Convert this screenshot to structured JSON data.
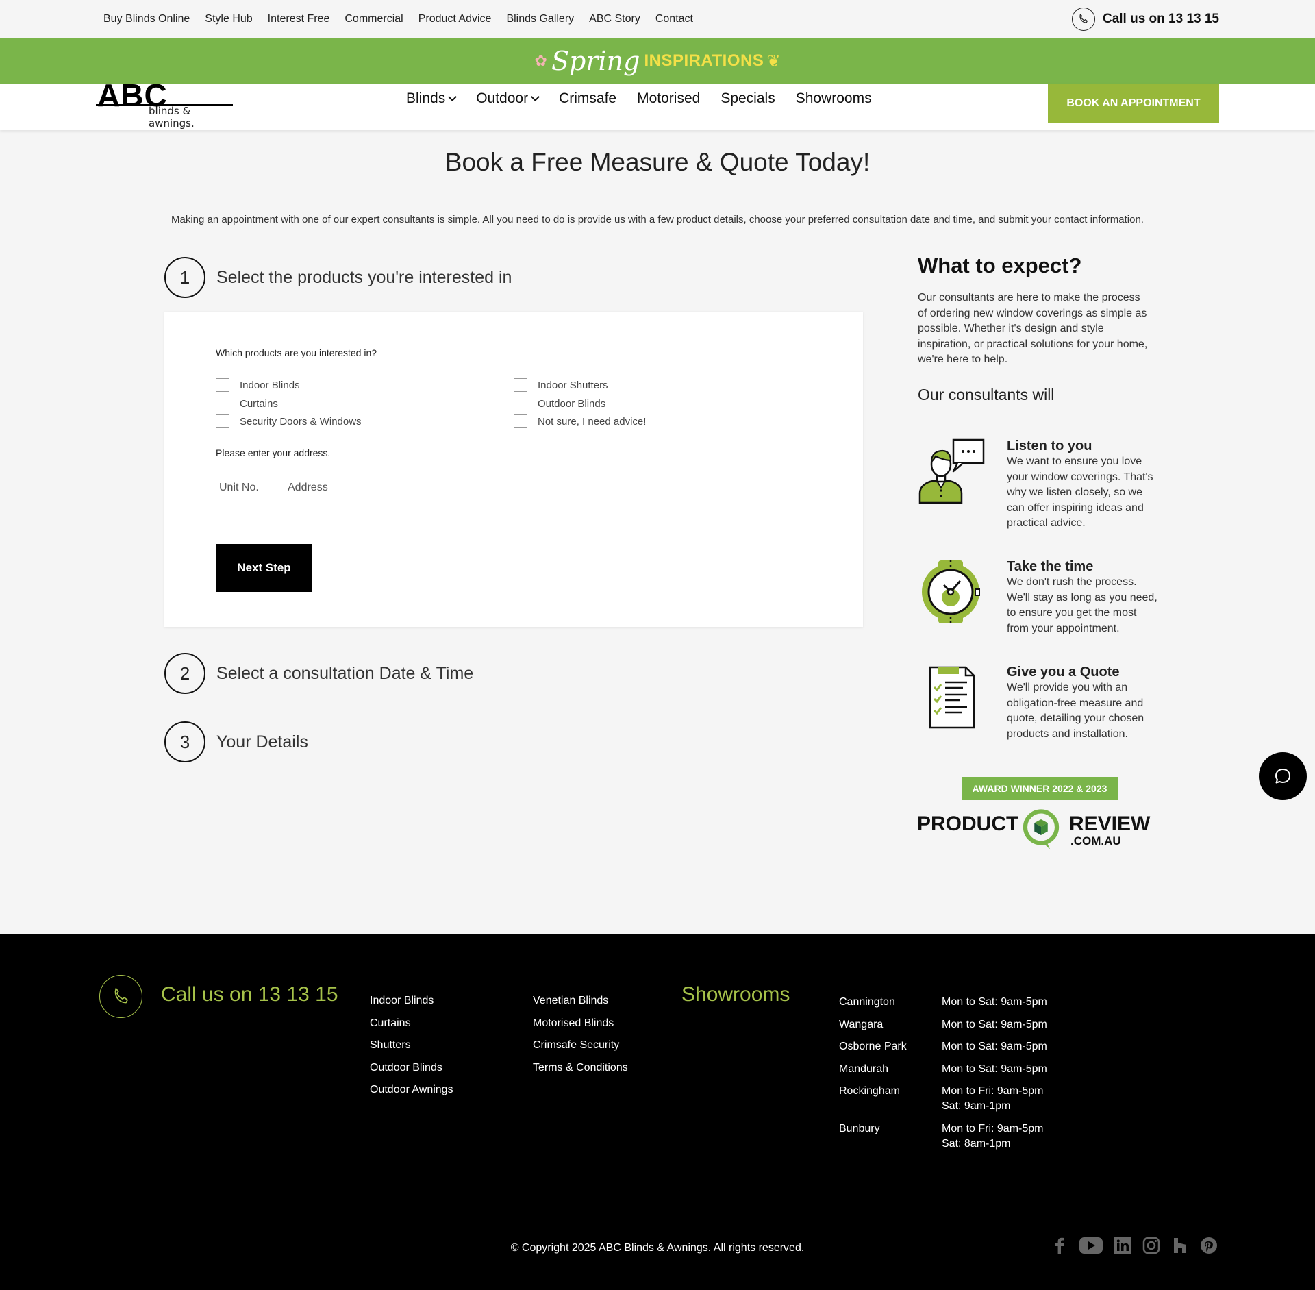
{
  "topnav": {
    "links": [
      "Buy Blinds Online",
      "Style Hub",
      "Interest Free",
      "Commercial",
      "Product Advice",
      "Blinds Gallery",
      "ABC Story",
      "Contact"
    ],
    "call": "Call us on 13 13 15"
  },
  "promo": {
    "script": "Spring",
    "word": "INSPIRATIONS"
  },
  "header": {
    "logo_main": "ABC",
    "logo_sub": "blinds & awnings.",
    "nav": [
      "Blinds",
      "Outdoor",
      "Crimsafe",
      "Motorised",
      "Specials",
      "Showrooms"
    ],
    "book": "BOOK AN APPOINTMENT"
  },
  "page": {
    "title": "Book a Free Measure & Quote Today!",
    "intro": "Making an appointment with one of our expert consultants is simple. All you need to do is provide us with a few product details, choose your preferred consultation date and time, and submit your contact information."
  },
  "steps": [
    {
      "num": "1",
      "title": "Select the products you're interested in"
    },
    {
      "num": "2",
      "title": "Select a consultation Date & Time"
    },
    {
      "num": "3",
      "title": "Your Details"
    }
  ],
  "form": {
    "products_q": "Which products are you interested in?",
    "products": [
      "Indoor Blinds",
      "Curtains",
      "Security Doors & Windows",
      "Indoor Shutters",
      "Outdoor Blinds",
      "Not sure, I need advice!"
    ],
    "address_q": "Please enter your address.",
    "unit_placeholder": "Unit No.",
    "address_placeholder": "Address",
    "next": "Next Step"
  },
  "sidebar": {
    "title": "What to expect?",
    "desc": "Our consultants are here to make the process of ordering new window coverings as simple as possible. Whether it's design and style inspiration, or practical solutions for your home, we're here to help.",
    "sub": "Our consultants will",
    "features": [
      {
        "title": "Listen to you",
        "desc": "We want to ensure you love your window coverings. That's why we listen closely, so we can offer inspiring ideas and practical advice."
      },
      {
        "title": "Take the time",
        "desc": "We don't rush the process. We'll stay as long as you need, to ensure you get the most from your appointment."
      },
      {
        "title": "Give you a Quote",
        "desc": "We'll provide you with an obligation-free measure and quote, detailing your chosen products and installation."
      }
    ],
    "award": "AWARD WINNER 2022 & 2023",
    "pr_left": "PRODUCT",
    "pr_right": "REVIEW",
    "pr_domain": ".COM.AU"
  },
  "footer": {
    "call": "Call us on 13 13 15",
    "col1": [
      "Indoor Blinds",
      "Curtains",
      "Shutters",
      "Outdoor Blinds",
      "Outdoor Awnings"
    ],
    "col2": [
      "Venetian Blinds",
      "Motorised Blinds",
      "Crimsafe Security",
      "Terms & Conditions"
    ],
    "showrooms_title": "Showrooms",
    "showrooms": [
      {
        "name": "Cannington",
        "hours": "Mon to Sat: 9am-5pm"
      },
      {
        "name": "Wangara",
        "hours": "Mon to Sat: 9am-5pm"
      },
      {
        "name": "Osborne Park",
        "hours": "Mon to Sat: 9am-5pm"
      },
      {
        "name": "Mandurah",
        "hours": "Mon to Sat: 9am-5pm"
      },
      {
        "name": "Rockingham",
        "hours": "Mon to Fri: 9am-5pm",
        "hours2": "Sat: 9am-1pm"
      },
      {
        "name": "Bunbury",
        "hours": "Mon to Fri: 9am-5pm",
        "hours2": "Sat: 8am-1pm"
      }
    ],
    "copyright": "© Copyright 2025 ABC Blinds & Awnings. All rights reserved.",
    "socials": [
      "facebook-icon",
      "youtube-icon",
      "linkedin-icon",
      "instagram-icon",
      "houzz-icon",
      "pinterest-icon"
    ]
  },
  "colors": {
    "green": "#7ab54a",
    "lime": "#97b83a",
    "footer_accent": "#a6c24a"
  }
}
